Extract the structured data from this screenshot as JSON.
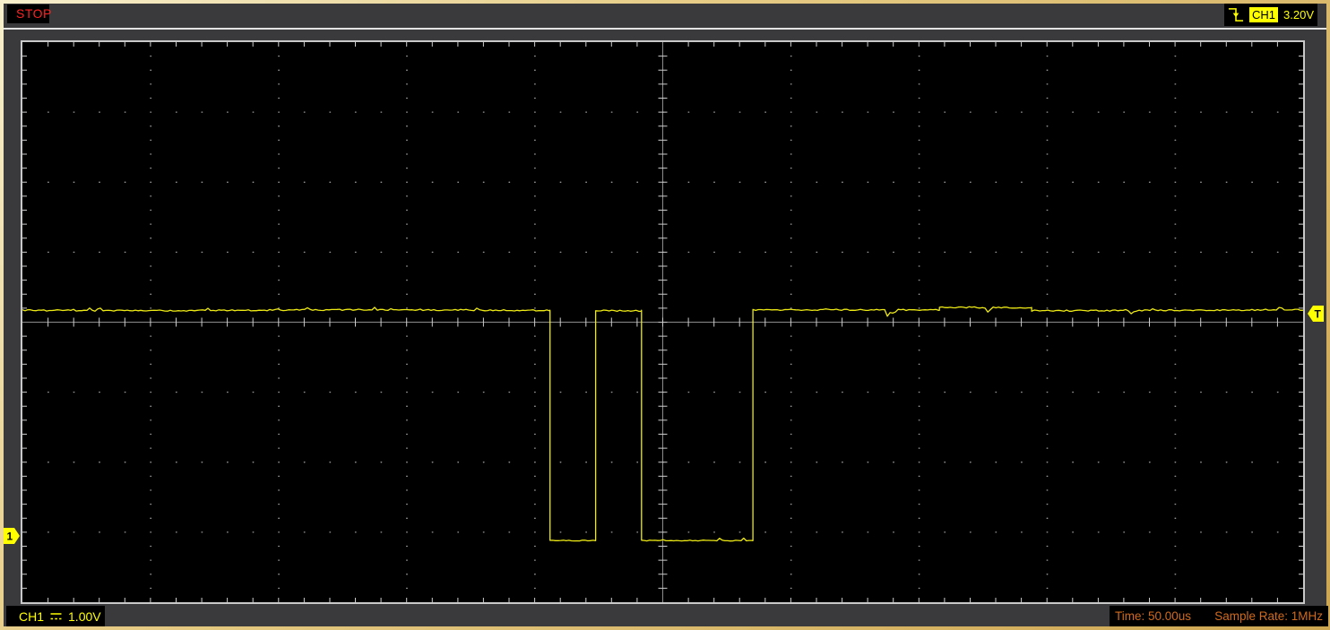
{
  "scope": {
    "run_state": "STOP",
    "trigger": {
      "source": "CH1",
      "level_label": "3.20V",
      "edge": "falling",
      "marker_label": "T"
    },
    "channel": {
      "label": "CH1",
      "coupling": "DC",
      "scale_label": "1.00V",
      "marker_label": "1"
    },
    "timebase_label": "Time: 50.00us",
    "sample_rate_label": "Sample Rate: 1MHz"
  },
  "colors": {
    "accent_yellow": "#ffff00",
    "trace": "#eeea14",
    "stop_red": "#ff2222",
    "info_orange": "#cf6a1e",
    "chrome": "#3a3a3c",
    "screen_bg": "#000000",
    "grid_dot": "#9a9a9a",
    "grid_line": "#8c8c8c",
    "grid_tick": "#cdcdcd",
    "frame_tan": "#d8b768"
  },
  "grid": {
    "h_divs": 10,
    "v_divs": 8,
    "minors_per_div": 5
  },
  "chart_data": {
    "type": "line",
    "title": "CH1 oscilloscope trace",
    "x_units": "us",
    "y_units": "V",
    "time_per_div_us": 50,
    "volts_per_div": 1.0,
    "x_range_us": [
      -250,
      250
    ],
    "ground_offset_divs_from_center": -3.05,
    "trigger_level_v": 3.2,
    "levels": {
      "high_v": 3.22,
      "low_v": -0.07
    },
    "segments": [
      {
        "t0": -250,
        "t1": -44,
        "v": 3.22
      },
      {
        "t0": -44,
        "t1": -26.2,
        "v": -0.07
      },
      {
        "t0": -26.2,
        "t1": -8.3,
        "v": 3.22
      },
      {
        "t0": -8.3,
        "t1": 35.2,
        "v": -0.07
      },
      {
        "t0": 35.2,
        "t1": 108,
        "v": 3.22
      },
      {
        "t0": 108,
        "t1": 144,
        "v": 3.26
      },
      {
        "t0": 144,
        "t1": 250,
        "v": 3.22
      }
    ],
    "noise_v": 0.02,
    "features": [
      {
        "t_us": 87.6,
        "dv_v": -0.09
      },
      {
        "t_us": 89.6,
        "dv_v": -0.07
      },
      {
        "t_us": 127.0,
        "dv_v": -0.06
      },
      {
        "t_us": 182.8,
        "dv_v": -0.05
      }
    ]
  }
}
